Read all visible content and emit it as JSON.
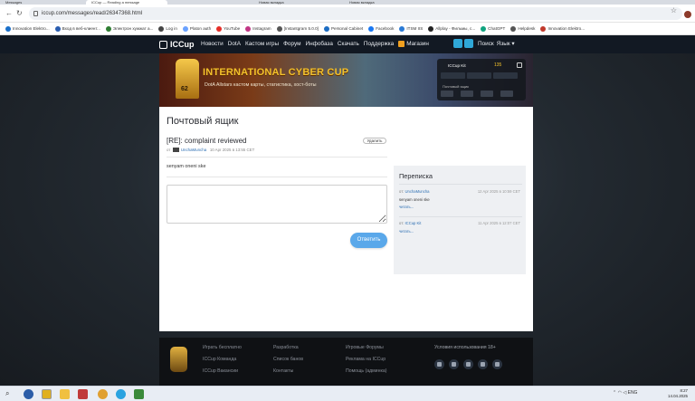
{
  "browser": {
    "tabs": [
      "Messages",
      "ICCup — Reading a message",
      "Новая вкладка",
      "Новая вкладка"
    ],
    "url": "iccup.com/messages/read/26347368.html",
    "bookmarks": [
      {
        "label": "Innovation Elektro...",
        "color": "#1a6fc9"
      },
      {
        "label": "Вход в веб-клиент...",
        "color": "#2a5db0"
      },
      {
        "label": "Электрон хужжат а...",
        "color": "#2e7d32"
      },
      {
        "label": "Log in",
        "color": "#444444"
      },
      {
        "label": "Platon auth",
        "color": "#6aa2ff"
      },
      {
        "label": "YouTube",
        "color": "#e52d27"
      },
      {
        "label": "Instagram",
        "color": "#c13584"
      },
      {
        "label": "[Instantgram 5.0.0]",
        "color": "#555555"
      },
      {
        "label": "Personal Cabinet",
        "color": "#1c6cc2"
      },
      {
        "label": "Facebook",
        "color": "#1877f2"
      },
      {
        "label": "ITSM IIS",
        "color": "#2a7ad5"
      },
      {
        "label": "Allplay - Фильмы, с...",
        "color": "#222222"
      },
      {
        "label": "ChatGPT",
        "color": "#10a37f"
      },
      {
        "label": "Helpdesk",
        "color": "#555555"
      },
      {
        "label": "Innovation Elektro...",
        "color": "#c0392b"
      }
    ]
  },
  "site": {
    "logo": "ICCup",
    "nav": [
      "Новости",
      "DotA",
      "Кастом игры",
      "Форум",
      "Инфобаза",
      "Скачать",
      "Поддержка"
    ],
    "shop": "Магазин",
    "search": "Поиск",
    "lang": "Язык ▾"
  },
  "banner": {
    "rank": "62",
    "headline": "INTERNATIONAL CYBER CUP",
    "subline": "DotA Allstars кастом карты, статистика, хост-боты",
    "kit_name": "ICCup Kit",
    "kit_coins": "135",
    "kit_label": "Почтовый ящик"
  },
  "mail": {
    "page_title": "Почтовый ящик",
    "subject": "[RE]: complaint reviewed",
    "delete_label": "Удалить",
    "from_prefix": "от",
    "author": "UnchaMuncha",
    "date": "10 Apr 2025 в 13:55 CET",
    "body": "senyam oneni ske",
    "reply_placeholder": "",
    "send_label": "Ответить"
  },
  "sidebar": {
    "title": "Переписка",
    "items": [
      {
        "from_prefix": "от:",
        "author": "UnchaMuncha",
        "date": "12 Apr 2025 в 10:59 CET",
        "snippet": "senyam oneni ske",
        "more": "читать..."
      },
      {
        "from_prefix": "от:",
        "author": "ICCup Kit",
        "date": "11 Apr 2025 в 12:07 CET",
        "snippet": "",
        "more": "читать..."
      }
    ]
  },
  "footer": {
    "col1": [
      "Играть бесплатно",
      "ICCup Команда",
      "ICCup Вакансии"
    ],
    "col2": [
      "Разработка",
      "Список банов",
      "Контакты"
    ],
    "col3": [
      "Игровые Форумы",
      "Реклама на ICCup",
      "Помощь (админка)"
    ],
    "terms": "Условия использования 18+",
    "social": [
      "vk-icon",
      "discord-icon",
      "discord-icon",
      "youtube-icon",
      "telegram-icon"
    ]
  },
  "taskbar": {
    "lang": "ENG",
    "time": "8:27",
    "date": "14.04.2025"
  }
}
